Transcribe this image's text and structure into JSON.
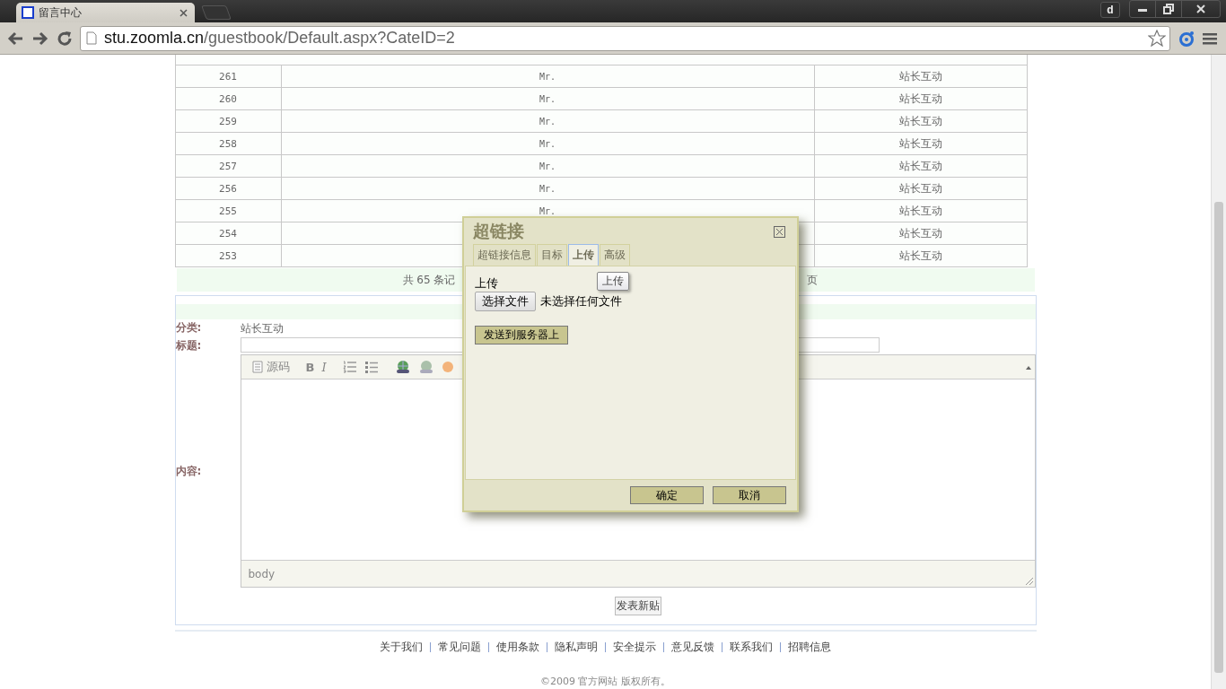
{
  "browser": {
    "tab_title": "留言中心",
    "profile_letter": "d",
    "url_host": "stu.zoomla.cn",
    "url_path": "/guestbook/Default.aspx?CateID=2"
  },
  "table": {
    "rows": [
      {
        "id": "261",
        "name": "Mr.",
        "category": "站长互动"
      },
      {
        "id": "260",
        "name": "Mr.",
        "category": "站长互动"
      },
      {
        "id": "259",
        "name": "Mr.",
        "category": "站长互动"
      },
      {
        "id": "258",
        "name": "Mr.",
        "category": "站长互动"
      },
      {
        "id": "257",
        "name": "Mr.",
        "category": "站长互动"
      },
      {
        "id": "256",
        "name": "Mr.",
        "category": "站长互动"
      },
      {
        "id": "255",
        "name": "Mr.",
        "category": "站长互动"
      },
      {
        "id": "254",
        "category": "站长互动"
      },
      {
        "id": "253",
        "category": "站长互动"
      }
    ]
  },
  "pagination": {
    "left": "共 65 条记",
    "right": "页"
  },
  "form": {
    "category_label": "分类:",
    "category_value": "站长互动",
    "title_label": "标题:",
    "content_label": "内容:",
    "toolbar": [
      {
        "kind": "source",
        "label": "源码"
      },
      {
        "kind": "bold",
        "label": "B"
      },
      {
        "kind": "italic",
        "label": "I"
      },
      {
        "kind": "ol"
      },
      {
        "kind": "ul"
      },
      {
        "kind": "link"
      },
      {
        "kind": "unlink"
      },
      {
        "kind": "smiley"
      }
    ],
    "status_path": "body",
    "submit": "发表新贴"
  },
  "footer": {
    "links": [
      "关于我们",
      "常见问题",
      "使用条款",
      "隐私声明",
      "安全提示",
      "意见反馈",
      "联系我们",
      "招聘信息"
    ],
    "copyright": "©2009 官方网站 版权所有。"
  },
  "dialog": {
    "title": "超链接",
    "tabs": [
      {
        "label": "超链接信息",
        "selected": false
      },
      {
        "label": "目标",
        "selected": false
      },
      {
        "label": "上传",
        "selected": true
      },
      {
        "label": "高级",
        "selected": false
      }
    ],
    "field_label": "上传",
    "choose_button": "选择文件",
    "file_status": "未选择任何文件",
    "send_button": "发送到服务器上",
    "tooltip": "上传",
    "ok": "确定",
    "cancel": "取消"
  }
}
